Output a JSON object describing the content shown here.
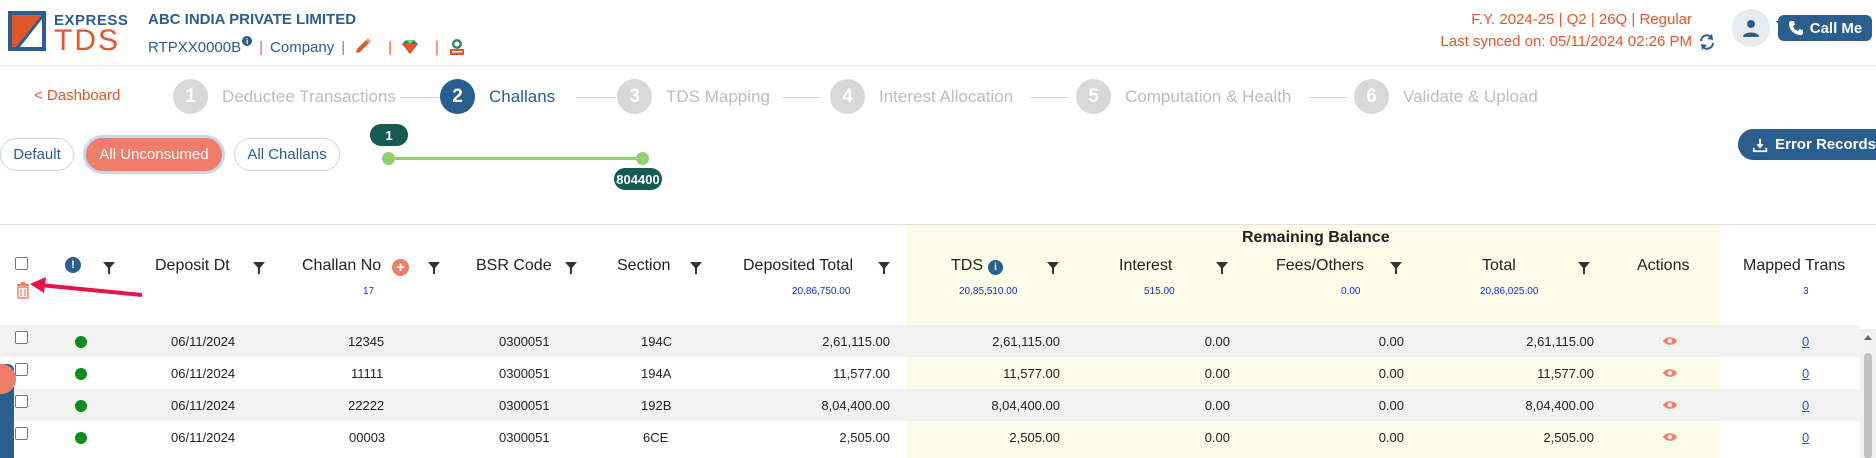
{
  "header": {
    "logo_express": "EXPRESS",
    "logo_tds": "TDS",
    "company_name": "ABC INDIA PRIVATE LIMITED",
    "tan": "RTPXX0000B",
    "info_glyph": "i",
    "company_type": "Company",
    "separator": "|",
    "fy_info": "F.Y. 2024-25  | Q2  | 26Q | Regular",
    "last_synced": "Last synced on: 05/11/2024 02:26 PM",
    "call_me": "Call Me",
    "icons": [
      "pencil-icon",
      "gem-icon",
      "certificate-icon",
      "sync-icon",
      "user-icon",
      "phone-icon"
    ]
  },
  "stepper": {
    "back": "< Dashboard",
    "steps": [
      {
        "num": "1",
        "label": "Deductee Transactions",
        "active": false
      },
      {
        "num": "2",
        "label": "Challans",
        "active": true
      },
      {
        "num": "3",
        "label": "TDS Mapping",
        "active": false
      },
      {
        "num": "4",
        "label": "Interest Allocation",
        "active": false
      },
      {
        "num": "5",
        "label": "Computation & Health",
        "active": false
      },
      {
        "num": "6",
        "label": "Validate & Upload",
        "active": false
      }
    ]
  },
  "filters": {
    "default": "Default",
    "all_unconsumed": "All Unconsumed",
    "all_challans": "All Challans",
    "selected": "All Unconsumed",
    "range_min": "1",
    "range_max": "804400",
    "error_records": "Error Records"
  },
  "table": {
    "remaining_balance": "Remaining Balance",
    "info_glyph": "!",
    "add_glyph": "+",
    "columns": {
      "deposit_dt": "Deposit Dt",
      "challan_no": "Challan No",
      "bsr_code": "BSR Code",
      "section": "Section",
      "deposited_total": "Deposited Total",
      "tds": "TDS",
      "interest": "Interest",
      "fees_others": "Fees/Others",
      "total": "Total",
      "actions": "Actions",
      "mapped_trans": "Mapped Trans"
    },
    "totals": {
      "challan_count": "17",
      "deposited_total": "20,86,750.00",
      "tds": "20,85,510.00",
      "interest": "515.00",
      "fees_others": "0.00",
      "total": "20,86,025.00",
      "mapped_trans": "3"
    },
    "rows": [
      {
        "deposit_dt": "06/11/2024",
        "challan_no": "12345",
        "bsr_code": "0300051",
        "section": "194C",
        "deposited_total": "2,61,115.00",
        "tds": "2,61,115.00",
        "interest": "0.00",
        "fees_others": "0.00",
        "total": "2,61,115.00",
        "mapped": "0"
      },
      {
        "deposit_dt": "06/11/2024",
        "challan_no": "11111",
        "bsr_code": "0300051",
        "section": "194A",
        "deposited_total": "11,577.00",
        "tds": "11,577.00",
        "interest": "0.00",
        "fees_others": "0.00",
        "total": "11,577.00",
        "mapped": "0"
      },
      {
        "deposit_dt": "06/11/2024",
        "challan_no": "22222",
        "bsr_code": "0300051",
        "section": "192B",
        "deposited_total": "8,04,400.00",
        "tds": "8,04,400.00",
        "interest": "0.00",
        "fees_others": "0.00",
        "total": "8,04,400.00",
        "mapped": "0"
      },
      {
        "deposit_dt": "06/11/2024",
        "challan_no": "00003",
        "bsr_code": "0300051",
        "section": "6CE",
        "deposited_total": "2,505.00",
        "tds": "2,505.00",
        "interest": "0.00",
        "fees_others": "0.00",
        "total": "2,505.00",
        "mapped": "0"
      }
    ]
  },
  "colors": {
    "brand_blue": "#2a5e8e",
    "accent_orange": "#e0582a",
    "active_pill": "#f07c6a",
    "status_green": "#0e8a1e",
    "slider_green": "#8fd06f",
    "slider_tag": "#175a52",
    "highlight_band": "#fdfce8"
  }
}
